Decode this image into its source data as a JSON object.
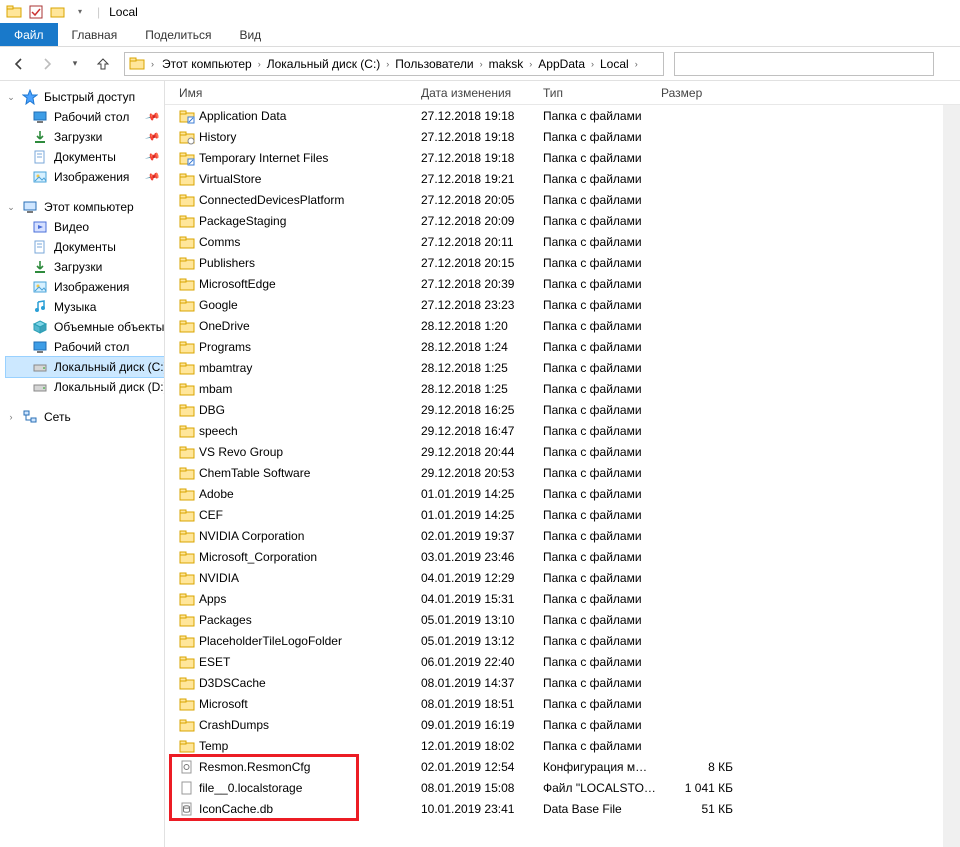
{
  "title_bar": {
    "location": "Local"
  },
  "ribbon": {
    "file": "Файл",
    "tabs": [
      "Главная",
      "Поделиться",
      "Вид"
    ]
  },
  "breadcrumb": [
    "Этот компьютер",
    "Локальный диск (C:)",
    "Пользователи",
    "maksk",
    "AppData",
    "Local"
  ],
  "sidebar": {
    "quick_access": {
      "label": "Быстрый доступ",
      "items": [
        {
          "label": "Рабочий стол",
          "icon": "desktop",
          "pinned": true
        },
        {
          "label": "Загрузки",
          "icon": "downloads",
          "pinned": true
        },
        {
          "label": "Документы",
          "icon": "documents",
          "pinned": true
        },
        {
          "label": "Изображения",
          "icon": "pictures",
          "pinned": true
        }
      ]
    },
    "this_pc": {
      "label": "Этот компьютер",
      "items": [
        {
          "label": "Видео",
          "icon": "video"
        },
        {
          "label": "Документы",
          "icon": "documents"
        },
        {
          "label": "Загрузки",
          "icon": "downloads"
        },
        {
          "label": "Изображения",
          "icon": "pictures"
        },
        {
          "label": "Музыка",
          "icon": "music"
        },
        {
          "label": "Объемные объекты",
          "icon": "objects3d"
        },
        {
          "label": "Рабочий стол",
          "icon": "desktop"
        },
        {
          "label": "Локальный диск (C:)",
          "icon": "drive",
          "selected": true
        },
        {
          "label": "Локальный диск (D:)",
          "icon": "drive"
        }
      ]
    },
    "network": {
      "label": "Сеть"
    }
  },
  "columns": {
    "name": "Имя",
    "date": "Дата изменения",
    "type": "Тип",
    "size": "Размер"
  },
  "files": [
    {
      "icon": "folder-shortcut",
      "name": "Application Data",
      "date": "27.12.2018 19:18",
      "type": "Папка с файлами",
      "size": ""
    },
    {
      "icon": "folder-link",
      "name": "History",
      "date": "27.12.2018 19:18",
      "type": "Папка с файлами",
      "size": ""
    },
    {
      "icon": "folder-shortcut",
      "name": "Temporary Internet Files",
      "date": "27.12.2018 19:18",
      "type": "Папка с файлами",
      "size": ""
    },
    {
      "icon": "folder",
      "name": "VirtualStore",
      "date": "27.12.2018 19:21",
      "type": "Папка с файлами",
      "size": ""
    },
    {
      "icon": "folder",
      "name": "ConnectedDevicesPlatform",
      "date": "27.12.2018 20:05",
      "type": "Папка с файлами",
      "size": ""
    },
    {
      "icon": "folder",
      "name": "PackageStaging",
      "date": "27.12.2018 20:09",
      "type": "Папка с файлами",
      "size": ""
    },
    {
      "icon": "folder",
      "name": "Comms",
      "date": "27.12.2018 20:11",
      "type": "Папка с файлами",
      "size": ""
    },
    {
      "icon": "folder",
      "name": "Publishers",
      "date": "27.12.2018 20:15",
      "type": "Папка с файлами",
      "size": ""
    },
    {
      "icon": "folder",
      "name": "MicrosoftEdge",
      "date": "27.12.2018 20:39",
      "type": "Папка с файлами",
      "size": ""
    },
    {
      "icon": "folder",
      "name": "Google",
      "date": "27.12.2018 23:23",
      "type": "Папка с файлами",
      "size": ""
    },
    {
      "icon": "folder",
      "name": "OneDrive",
      "date": "28.12.2018 1:20",
      "type": "Папка с файлами",
      "size": ""
    },
    {
      "icon": "folder",
      "name": "Programs",
      "date": "28.12.2018 1:24",
      "type": "Папка с файлами",
      "size": ""
    },
    {
      "icon": "folder",
      "name": "mbamtray",
      "date": "28.12.2018 1:25",
      "type": "Папка с файлами",
      "size": ""
    },
    {
      "icon": "folder",
      "name": "mbam",
      "date": "28.12.2018 1:25",
      "type": "Папка с файлами",
      "size": ""
    },
    {
      "icon": "folder",
      "name": "DBG",
      "date": "29.12.2018 16:25",
      "type": "Папка с файлами",
      "size": ""
    },
    {
      "icon": "folder",
      "name": "speech",
      "date": "29.12.2018 16:47",
      "type": "Папка с файлами",
      "size": ""
    },
    {
      "icon": "folder",
      "name": "VS Revo Group",
      "date": "29.12.2018 20:44",
      "type": "Папка с файлами",
      "size": ""
    },
    {
      "icon": "folder",
      "name": "ChemTable Software",
      "date": "29.12.2018 20:53",
      "type": "Папка с файлами",
      "size": ""
    },
    {
      "icon": "folder",
      "name": "Adobe",
      "date": "01.01.2019 14:25",
      "type": "Папка с файлами",
      "size": ""
    },
    {
      "icon": "folder",
      "name": "CEF",
      "date": "01.01.2019 14:25",
      "type": "Папка с файлами",
      "size": ""
    },
    {
      "icon": "folder",
      "name": "NVIDIA Corporation",
      "date": "02.01.2019 19:37",
      "type": "Папка с файлами",
      "size": ""
    },
    {
      "icon": "folder",
      "name": "Microsoft_Corporation",
      "date": "03.01.2019 23:46",
      "type": "Папка с файлами",
      "size": ""
    },
    {
      "icon": "folder",
      "name": "NVIDIA",
      "date": "04.01.2019 12:29",
      "type": "Папка с файлами",
      "size": ""
    },
    {
      "icon": "folder",
      "name": "Apps",
      "date": "04.01.2019 15:31",
      "type": "Папка с файлами",
      "size": ""
    },
    {
      "icon": "folder",
      "name": "Packages",
      "date": "05.01.2019 13:10",
      "type": "Папка с файлами",
      "size": ""
    },
    {
      "icon": "folder",
      "name": "PlaceholderTileLogoFolder",
      "date": "05.01.2019 13:12",
      "type": "Папка с файлами",
      "size": ""
    },
    {
      "icon": "folder",
      "name": "ESET",
      "date": "06.01.2019 22:40",
      "type": "Папка с файлами",
      "size": ""
    },
    {
      "icon": "folder",
      "name": "D3DSCache",
      "date": "08.01.2019 14:37",
      "type": "Папка с файлами",
      "size": ""
    },
    {
      "icon": "folder",
      "name": "Microsoft",
      "date": "08.01.2019 18:51",
      "type": "Папка с файлами",
      "size": ""
    },
    {
      "icon": "folder",
      "name": "CrashDumps",
      "date": "09.01.2019 16:19",
      "type": "Папка с файлами",
      "size": ""
    },
    {
      "icon": "folder",
      "name": "Temp",
      "date": "12.01.2019 18:02",
      "type": "Папка с файлами",
      "size": ""
    },
    {
      "icon": "file-cfg",
      "name": "Resmon.ResmonCfg",
      "date": "02.01.2019 12:54",
      "type": "Конфигурация м…",
      "size": "8 КБ"
    },
    {
      "icon": "file",
      "name": "file__0.localstorage",
      "date": "08.01.2019 15:08",
      "type": "Файл \"LOCALSTO…",
      "size": "1 041 КБ"
    },
    {
      "icon": "file-db",
      "name": "IconCache.db",
      "date": "10.01.2019 23:41",
      "type": "Data Base File",
      "size": "51 КБ"
    }
  ],
  "highlight": {
    "start_index": 31,
    "end_index": 33
  }
}
